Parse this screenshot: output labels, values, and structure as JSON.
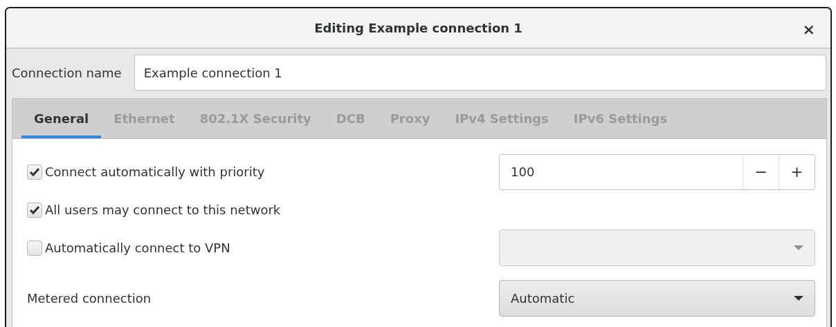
{
  "window": {
    "title": "Editing Example connection 1",
    "close": "×"
  },
  "connection_name": {
    "label": "Connection name",
    "value": "Example connection 1"
  },
  "tabs": [
    {
      "label": "General",
      "selected": true
    },
    {
      "label": "Ethernet",
      "selected": false
    },
    {
      "label": "802.1X Security",
      "selected": false
    },
    {
      "label": "DCB",
      "selected": false
    },
    {
      "label": "Proxy",
      "selected": false
    },
    {
      "label": "IPv4 Settings",
      "selected": false
    },
    {
      "label": "IPv6 Settings",
      "selected": false
    }
  ],
  "rows": [
    {
      "kind": "checkbox",
      "label": "Connect automatically with priority",
      "checked": true,
      "control": {
        "kind": "spin",
        "value": "100",
        "decrement": "−",
        "increment": "+"
      }
    },
    {
      "kind": "checkbox",
      "label": "All users may connect to this network",
      "checked": true
    },
    {
      "kind": "checkbox",
      "label": "Automatically connect to VPN",
      "checked": false,
      "control": {
        "kind": "dropdown",
        "disabled": true
      }
    },
    {
      "kind": "label",
      "label": "Metered connection",
      "control": {
        "kind": "dropdown",
        "disabled": false,
        "value": "Automatic"
      }
    }
  ]
}
